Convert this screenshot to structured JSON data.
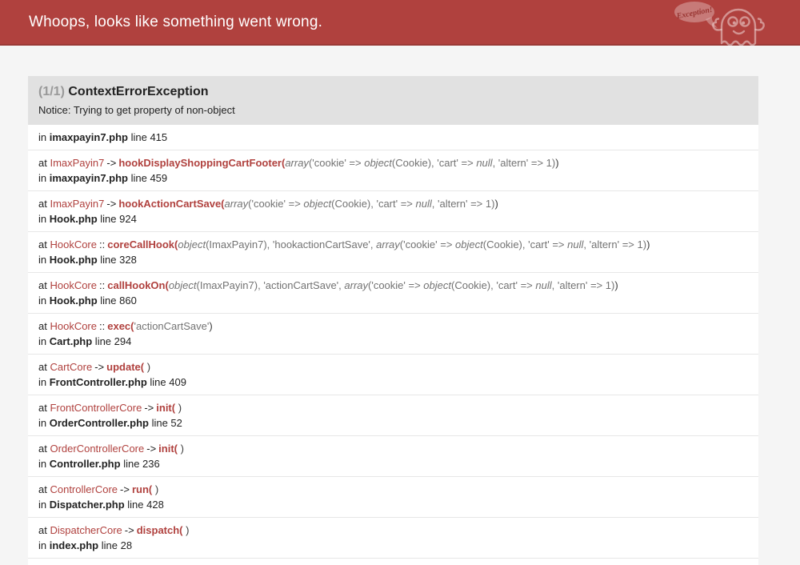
{
  "header": {
    "title": "Whoops, looks like something went wrong.",
    "bubble_text": "Exception!"
  },
  "exception": {
    "counter": "(1/1)",
    "class_name": "ContextErrorException",
    "message": "Notice: Trying to get property of non-object"
  },
  "trace": {
    "labels": {
      "at": "at",
      "in": "in",
      "line": "line"
    },
    "rows": [
      {
        "file": "imaxpayin7.php",
        "line": "415"
      },
      {
        "call": {
          "cls": "ImaxPayin7",
          "type": "->",
          "method": "hookDisplayShoppingCartFooter",
          "args": [
            [
              "em",
              "array"
            ],
            [
              "t",
              "('cookie' => "
            ],
            [
              "em",
              "object"
            ],
            [
              "t",
              "(Cookie), 'cart' => "
            ],
            [
              "em",
              "null"
            ],
            [
              "t",
              ", 'altern' => 1)"
            ]
          ]
        },
        "file": "imaxpayin7.php",
        "line": "459"
      },
      {
        "call": {
          "cls": "ImaxPayin7",
          "type": "->",
          "method": "hookActionCartSave",
          "args": [
            [
              "em",
              "array"
            ],
            [
              "t",
              "('cookie' => "
            ],
            [
              "em",
              "object"
            ],
            [
              "t",
              "(Cookie), 'cart' => "
            ],
            [
              "em",
              "null"
            ],
            [
              "t",
              ", 'altern' => 1)"
            ]
          ]
        },
        "file": "Hook.php",
        "line": "924"
      },
      {
        "call": {
          "cls": "HookCore",
          "type": "::",
          "method": "coreCallHook",
          "args": [
            [
              "em",
              "object"
            ],
            [
              "t",
              "(ImaxPayin7), 'hookactionCartSave', "
            ],
            [
              "em",
              "array"
            ],
            [
              "t",
              "('cookie' => "
            ],
            [
              "em",
              "object"
            ],
            [
              "t",
              "(Cookie), 'cart' => "
            ],
            [
              "em",
              "null"
            ],
            [
              "t",
              ", 'altern' => 1)"
            ]
          ]
        },
        "file": "Hook.php",
        "line": "328"
      },
      {
        "call": {
          "cls": "HookCore",
          "type": "::",
          "method": "callHookOn",
          "args": [
            [
              "em",
              "object"
            ],
            [
              "t",
              "(ImaxPayin7), 'actionCartSave', "
            ],
            [
              "em",
              "array"
            ],
            [
              "t",
              "('cookie' => "
            ],
            [
              "em",
              "object"
            ],
            [
              "t",
              "(Cookie), 'cart' => "
            ],
            [
              "em",
              "null"
            ],
            [
              "t",
              ", 'altern' => 1)"
            ]
          ]
        },
        "file": "Hook.php",
        "line": "860"
      },
      {
        "call": {
          "cls": "HookCore",
          "type": "::",
          "method": "exec",
          "args": [
            [
              "t",
              "'actionCartSave'"
            ]
          ]
        },
        "file": "Cart.php",
        "line": "294"
      },
      {
        "call": {
          "cls": "CartCore",
          "type": "->",
          "method": "update",
          "args": []
        },
        "file": "FrontController.php",
        "line": "409"
      },
      {
        "call": {
          "cls": "FrontControllerCore",
          "type": "->",
          "method": "init",
          "args": []
        },
        "file": "OrderController.php",
        "line": "52"
      },
      {
        "call": {
          "cls": "OrderControllerCore",
          "type": "->",
          "method": "init",
          "args": []
        },
        "file": "Controller.php",
        "line": "236"
      },
      {
        "call": {
          "cls": "ControllerCore",
          "type": "->",
          "method": "run",
          "args": []
        },
        "file": "Dispatcher.php",
        "line": "428"
      },
      {
        "call": {
          "cls": "DispatcherCore",
          "type": "->",
          "method": "dispatch",
          "args": []
        },
        "file": "index.php",
        "line": "28"
      }
    ]
  },
  "colors": {
    "header_bg": "#B0413E",
    "accent": "#B0413E",
    "head_bg": "#E1E1E1",
    "page_bg": "#F5F5F5",
    "args_text": "#737373"
  }
}
